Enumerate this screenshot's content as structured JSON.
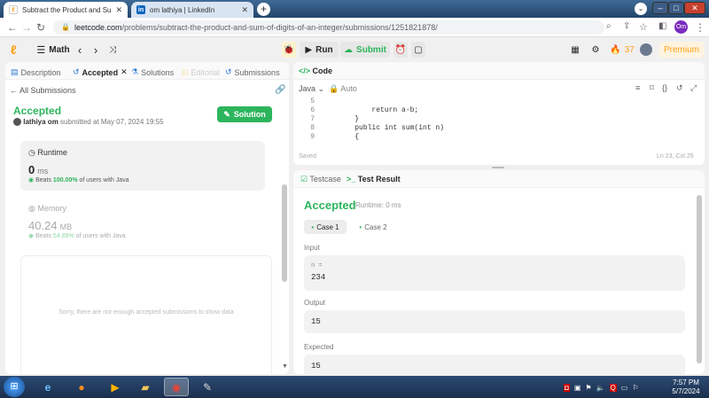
{
  "browser": {
    "tabs": [
      {
        "title": "Subtract the Product and Sum of",
        "icon": "leetcode-icon"
      },
      {
        "title": "om lathiya | LinkedIn",
        "icon": "linkedin-icon"
      }
    ],
    "url_host": "leetcode.com",
    "url_path": "/problems/subtract-the-product-and-sum-of-digits-of-an-integer/submissions/1251821878/",
    "profile_initials": "Om"
  },
  "toolbar": {
    "problem_list": "Math",
    "run": "Run",
    "submit": "Submit",
    "streak": "37",
    "premium": "Premium"
  },
  "left_tabs": [
    {
      "label": "Description"
    },
    {
      "label": "Accepted"
    },
    {
      "label": "Solutions"
    },
    {
      "label": "Editorial"
    },
    {
      "label": "Submissions"
    }
  ],
  "submission": {
    "back_label": "All Submissions",
    "status": "Accepted",
    "user": "lathiya om",
    "submitted_text": "submitted at May 07, 2024 19:55",
    "solution_button": "Solution",
    "runtime_title": "Runtime",
    "runtime_value": "0",
    "runtime_unit": "ms",
    "runtime_beats_prefix": "Beats",
    "runtime_beats_pct": "100.00%",
    "runtime_beats_suffix": "of users with Java",
    "memory_title": "Memory",
    "memory_value": "40.24",
    "memory_unit": "MB",
    "memory_beats_prefix": "Beats",
    "memory_beats_pct": "54.89%",
    "memory_beats_suffix": "of users with Java",
    "not_enough": "Sorry, there are not enough accepted submissions to show data"
  },
  "editor": {
    "title": "Code",
    "language": "Java",
    "mode": "Auto",
    "lines": [
      {
        "n": "5",
        "text": ""
      },
      {
        "n": "6",
        "text": "        return a-b;"
      },
      {
        "n": "7",
        "text": "    }"
      },
      {
        "n": "8",
        "text": "    public int sum(int n)"
      },
      {
        "n": "9",
        "text": "    {"
      }
    ],
    "saved": "Saved",
    "position": "Ln 23, Col 25"
  },
  "console": {
    "testcase_tab": "Testcase",
    "result_tab": "Test Result",
    "status": "Accepted",
    "runtime": "Runtime: 0 ms",
    "cases": [
      "Case 1",
      "Case 2"
    ],
    "input_label": "Input",
    "input_var": "n =",
    "input_value": "234",
    "output_label": "Output",
    "output_value": "15",
    "expected_label": "Expected",
    "expected_value": "15"
  },
  "taskbar": {
    "time": "7:57 PM",
    "date": "5/7/2024"
  },
  "colors": {
    "accent_green": "#2db55d",
    "brand_orange": "#ffa116",
    "premium_bg": "#fff4e0"
  }
}
